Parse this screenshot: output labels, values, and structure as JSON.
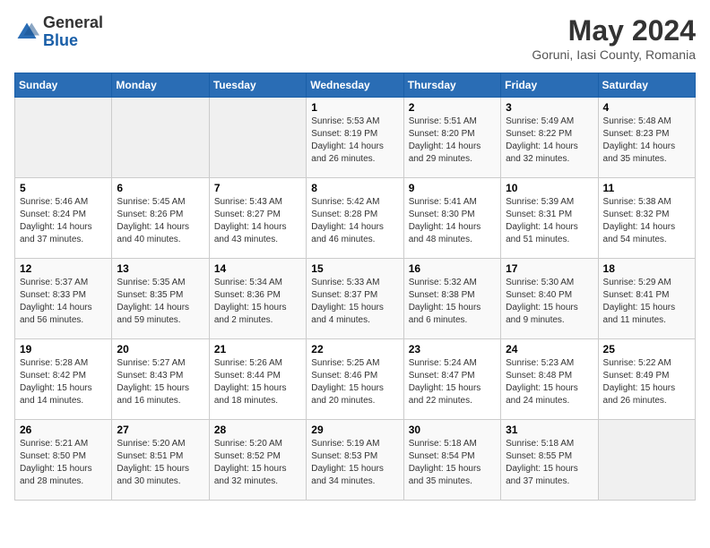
{
  "header": {
    "logo_general": "General",
    "logo_blue": "Blue",
    "month_title": "May 2024",
    "location": "Goruni, Iasi County, Romania"
  },
  "weekdays": [
    "Sunday",
    "Monday",
    "Tuesday",
    "Wednesday",
    "Thursday",
    "Friday",
    "Saturday"
  ],
  "weeks": [
    {
      "days": [
        {
          "num": "",
          "info": ""
        },
        {
          "num": "",
          "info": ""
        },
        {
          "num": "",
          "info": ""
        },
        {
          "num": "1",
          "info": "Sunrise: 5:53 AM\nSunset: 8:19 PM\nDaylight: 14 hours and 26 minutes."
        },
        {
          "num": "2",
          "info": "Sunrise: 5:51 AM\nSunset: 8:20 PM\nDaylight: 14 hours and 29 minutes."
        },
        {
          "num": "3",
          "info": "Sunrise: 5:49 AM\nSunset: 8:22 PM\nDaylight: 14 hours and 32 minutes."
        },
        {
          "num": "4",
          "info": "Sunrise: 5:48 AM\nSunset: 8:23 PM\nDaylight: 14 hours and 35 minutes."
        }
      ]
    },
    {
      "days": [
        {
          "num": "5",
          "info": "Sunrise: 5:46 AM\nSunset: 8:24 PM\nDaylight: 14 hours and 37 minutes."
        },
        {
          "num": "6",
          "info": "Sunrise: 5:45 AM\nSunset: 8:26 PM\nDaylight: 14 hours and 40 minutes."
        },
        {
          "num": "7",
          "info": "Sunrise: 5:43 AM\nSunset: 8:27 PM\nDaylight: 14 hours and 43 minutes."
        },
        {
          "num": "8",
          "info": "Sunrise: 5:42 AM\nSunset: 8:28 PM\nDaylight: 14 hours and 46 minutes."
        },
        {
          "num": "9",
          "info": "Sunrise: 5:41 AM\nSunset: 8:30 PM\nDaylight: 14 hours and 48 minutes."
        },
        {
          "num": "10",
          "info": "Sunrise: 5:39 AM\nSunset: 8:31 PM\nDaylight: 14 hours and 51 minutes."
        },
        {
          "num": "11",
          "info": "Sunrise: 5:38 AM\nSunset: 8:32 PM\nDaylight: 14 hours and 54 minutes."
        }
      ]
    },
    {
      "days": [
        {
          "num": "12",
          "info": "Sunrise: 5:37 AM\nSunset: 8:33 PM\nDaylight: 14 hours and 56 minutes."
        },
        {
          "num": "13",
          "info": "Sunrise: 5:35 AM\nSunset: 8:35 PM\nDaylight: 14 hours and 59 minutes."
        },
        {
          "num": "14",
          "info": "Sunrise: 5:34 AM\nSunset: 8:36 PM\nDaylight: 15 hours and 2 minutes."
        },
        {
          "num": "15",
          "info": "Sunrise: 5:33 AM\nSunset: 8:37 PM\nDaylight: 15 hours and 4 minutes."
        },
        {
          "num": "16",
          "info": "Sunrise: 5:32 AM\nSunset: 8:38 PM\nDaylight: 15 hours and 6 minutes."
        },
        {
          "num": "17",
          "info": "Sunrise: 5:30 AM\nSunset: 8:40 PM\nDaylight: 15 hours and 9 minutes."
        },
        {
          "num": "18",
          "info": "Sunrise: 5:29 AM\nSunset: 8:41 PM\nDaylight: 15 hours and 11 minutes."
        }
      ]
    },
    {
      "days": [
        {
          "num": "19",
          "info": "Sunrise: 5:28 AM\nSunset: 8:42 PM\nDaylight: 15 hours and 14 minutes."
        },
        {
          "num": "20",
          "info": "Sunrise: 5:27 AM\nSunset: 8:43 PM\nDaylight: 15 hours and 16 minutes."
        },
        {
          "num": "21",
          "info": "Sunrise: 5:26 AM\nSunset: 8:44 PM\nDaylight: 15 hours and 18 minutes."
        },
        {
          "num": "22",
          "info": "Sunrise: 5:25 AM\nSunset: 8:46 PM\nDaylight: 15 hours and 20 minutes."
        },
        {
          "num": "23",
          "info": "Sunrise: 5:24 AM\nSunset: 8:47 PM\nDaylight: 15 hours and 22 minutes."
        },
        {
          "num": "24",
          "info": "Sunrise: 5:23 AM\nSunset: 8:48 PM\nDaylight: 15 hours and 24 minutes."
        },
        {
          "num": "25",
          "info": "Sunrise: 5:22 AM\nSunset: 8:49 PM\nDaylight: 15 hours and 26 minutes."
        }
      ]
    },
    {
      "days": [
        {
          "num": "26",
          "info": "Sunrise: 5:21 AM\nSunset: 8:50 PM\nDaylight: 15 hours and 28 minutes."
        },
        {
          "num": "27",
          "info": "Sunrise: 5:20 AM\nSunset: 8:51 PM\nDaylight: 15 hours and 30 minutes."
        },
        {
          "num": "28",
          "info": "Sunrise: 5:20 AM\nSunset: 8:52 PM\nDaylight: 15 hours and 32 minutes."
        },
        {
          "num": "29",
          "info": "Sunrise: 5:19 AM\nSunset: 8:53 PM\nDaylight: 15 hours and 34 minutes."
        },
        {
          "num": "30",
          "info": "Sunrise: 5:18 AM\nSunset: 8:54 PM\nDaylight: 15 hours and 35 minutes."
        },
        {
          "num": "31",
          "info": "Sunrise: 5:18 AM\nSunset: 8:55 PM\nDaylight: 15 hours and 37 minutes."
        },
        {
          "num": "",
          "info": ""
        }
      ]
    }
  ]
}
